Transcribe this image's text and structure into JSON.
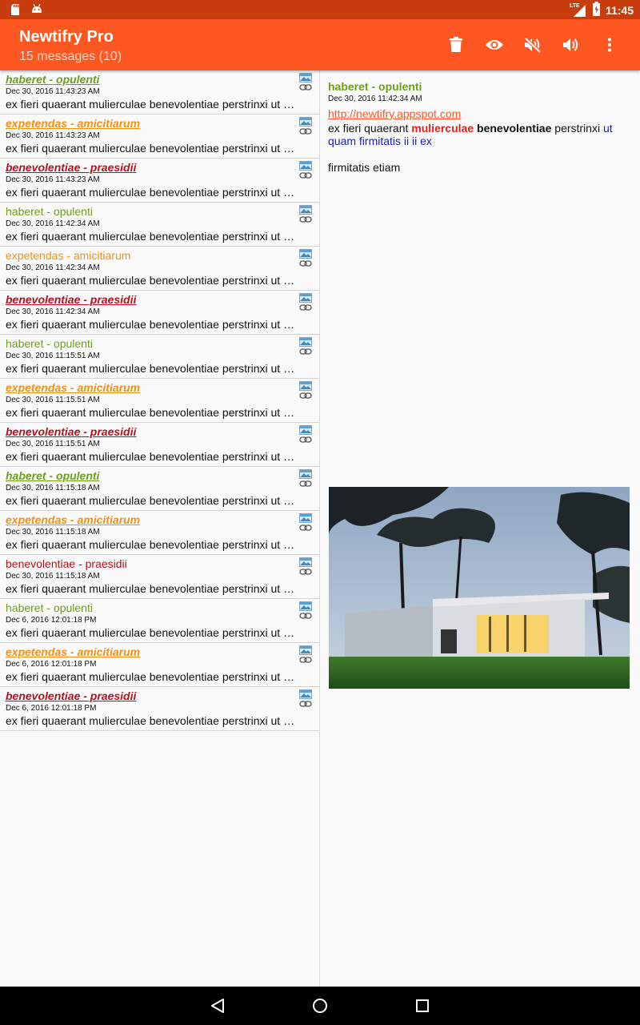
{
  "status_bar": {
    "network": "LTE",
    "time": "11:45"
  },
  "app_bar": {
    "title": "Newtifry Pro",
    "subtitle": "15 messages (10)",
    "actions": [
      "delete-icon",
      "eye-icon",
      "volume-off-icon",
      "volume-up-icon",
      "more-vert-icon"
    ]
  },
  "messages": [
    {
      "title": "haberet - opulenti",
      "date": "Dec 30, 2016 11:43:23 AM",
      "text": "ex fieri quaerant mulierculae benevolentiae perstrinxi ut q...",
      "color": "green",
      "unread": true
    },
    {
      "title": "expetendas - amicitiarum",
      "date": "Dec 30, 2016 11:43:23 AM",
      "text": "ex fieri quaerant mulierculae benevolentiae perstrinxi ut q...",
      "color": "orange",
      "unread": true
    },
    {
      "title": "benevolentiae - praesidii",
      "date": "Dec 30, 2016 11:43:23 AM",
      "text": "ex fieri quaerant mulierculae benevolentiae perstrinxi ut q...",
      "color": "red",
      "unread": true
    },
    {
      "title": "haberet - opulenti",
      "date": "Dec 30, 2016 11:42:34 AM",
      "text": "ex fieri quaerant mulierculae benevolentiae perstrinxi ut q...",
      "color": "green",
      "unread": false
    },
    {
      "title": "expetendas - amicitiarum",
      "date": "Dec 30, 2016 11:42:34 AM",
      "text": "ex fieri quaerant mulierculae benevolentiae perstrinxi ut q...",
      "color": "orange",
      "unread": false
    },
    {
      "title": "benevolentiae - praesidii",
      "date": "Dec 30, 2016 11:42:34 AM",
      "text": "ex fieri quaerant mulierculae benevolentiae perstrinxi ut q...",
      "color": "red",
      "unread": true
    },
    {
      "title": "haberet - opulenti",
      "date": "Dec 30, 2016 11:15:51 AM",
      "text": "ex fieri quaerant mulierculae benevolentiae perstrinxi ut q...",
      "color": "green",
      "unread": false
    },
    {
      "title": "expetendas - amicitiarum",
      "date": "Dec 30, 2016 11:15:51 AM",
      "text": "ex fieri quaerant mulierculae benevolentiae perstrinxi ut q...",
      "color": "orange",
      "unread": true
    },
    {
      "title": "benevolentiae - praesidii",
      "date": "Dec 30, 2016 11:15:51 AM",
      "text": "ex fieri quaerant mulierculae benevolentiae perstrinxi ut q...",
      "color": "red",
      "unread": true
    },
    {
      "title": "haberet - opulenti",
      "date": "Dec 30, 2016 11:15:18 AM",
      "text": "ex fieri quaerant mulierculae benevolentiae perstrinxi ut q...",
      "color": "green",
      "unread": true
    },
    {
      "title": "expetendas - amicitiarum",
      "date": "Dec 30, 2016 11:15:18 AM",
      "text": "ex fieri quaerant mulierculae benevolentiae perstrinxi ut q...",
      "color": "orange",
      "unread": true
    },
    {
      "title": "benevolentiae - praesidii",
      "date": "Dec 30, 2016 11:15:18 AM",
      "text": "ex fieri quaerant mulierculae benevolentiae perstrinxi ut q...",
      "color": "red",
      "unread": false
    },
    {
      "title": "haberet - opulenti",
      "date": "Dec 6, 2016 12:01:18 PM",
      "text": "ex fieri quaerant mulierculae benevolentiae perstrinxi ut q...",
      "color": "green",
      "unread": false
    },
    {
      "title": "expetendas - amicitiarum",
      "date": "Dec 6, 2016 12:01:18 PM",
      "text": "ex fieri quaerant mulierculae benevolentiae perstrinxi ut q...",
      "color": "orange",
      "unread": true
    },
    {
      "title": "benevolentiae - praesidii",
      "date": "Dec 6, 2016 12:01:18 PM",
      "text": "ex fieri quaerant mulierculae benevolentiae perstrinxi ut q...",
      "color": "red",
      "unread": true
    }
  ],
  "detail": {
    "title": "haberet - opulenti",
    "date": "Dec 30, 2016 11:42:34 AM",
    "link": "http://newtifry.appspot.com",
    "body": {
      "plain1": "ex fieri quaerant ",
      "red": "mulierculae",
      "space": " ",
      "bold": "benevolentiae",
      "plain2": " perstrinxi ",
      "blue": "ut quam firmitatis ii ii ex"
    },
    "extra": "firmitatis etiam"
  },
  "colors": {
    "accent": "#ff5722",
    "status_bar": "#c73d0e",
    "green": "#6d9f1c",
    "orange": "#f29013",
    "red": "#b5121b"
  }
}
